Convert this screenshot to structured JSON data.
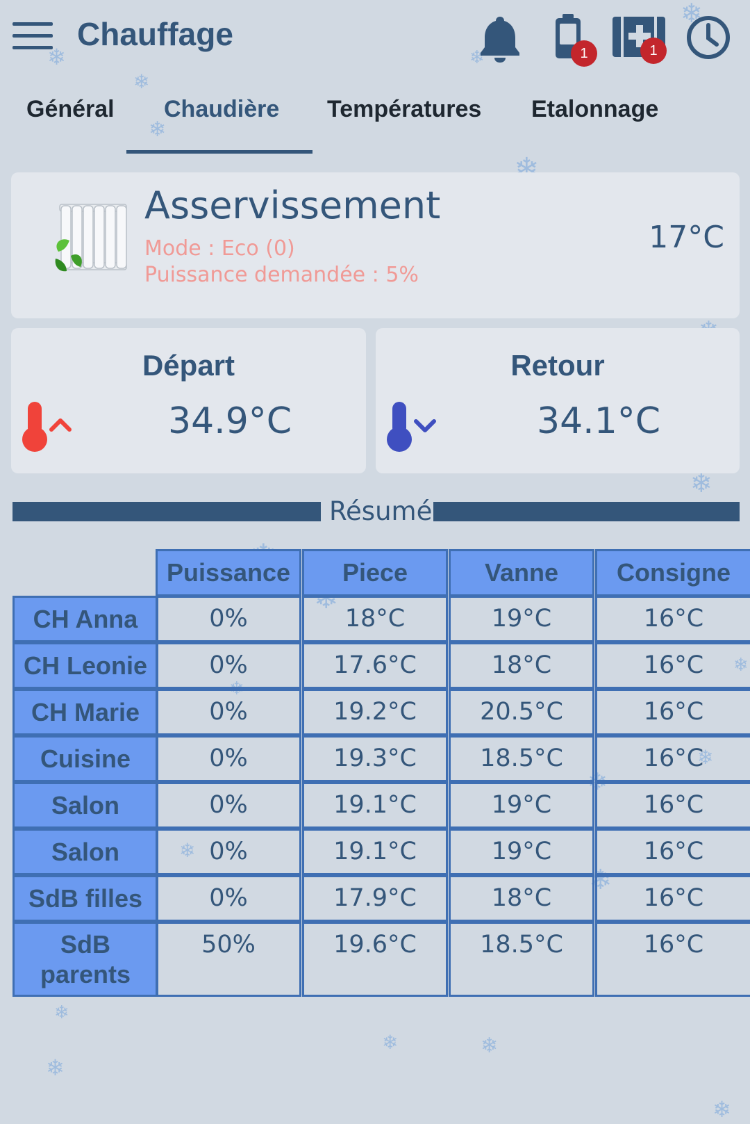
{
  "header": {
    "title": "Chauffage",
    "icons": {
      "menu": "hamburger-menu-icon",
      "notifications": "bell-icon",
      "battery": "battery-icon",
      "medical": "medical-kit-icon",
      "history": "clock-icon"
    },
    "battery_badge": "1",
    "medical_badge": "1"
  },
  "tabs": [
    {
      "label": "Général",
      "active": false
    },
    {
      "label": "Chaudière",
      "active": true
    },
    {
      "label": "Températures",
      "active": false
    },
    {
      "label": "Etalonnage",
      "active": false
    }
  ],
  "servo": {
    "title": "Asservissement",
    "mode": "Mode : Eco (0)",
    "power": "Puissance demandée : 5%",
    "temperature": "17°C",
    "icon": "radiator-eco-icon"
  },
  "depart": {
    "title": "Départ",
    "value": "34.9°C",
    "icon": "thermometer-up-icon"
  },
  "retour": {
    "title": "Retour",
    "value": "34.1°C",
    "icon": "thermometer-down-icon"
  },
  "summary": {
    "title": "Résumé",
    "columns": [
      "Puissance",
      "Piece",
      "Vanne",
      "Consigne"
    ],
    "rows": [
      {
        "name": "CH Anna",
        "values": [
          "0%",
          "18°C",
          "19°C",
          "16°C"
        ]
      },
      {
        "name": "CH Leonie",
        "values": [
          "0%",
          "17.6°C",
          "18°C",
          "16°C"
        ]
      },
      {
        "name": "CH Marie",
        "values": [
          "0%",
          "19.2°C",
          "20.5°C",
          "16°C"
        ]
      },
      {
        "name": "Cuisine",
        "values": [
          "0%",
          "19.3°C",
          "18.5°C",
          "16°C"
        ]
      },
      {
        "name": "Salon",
        "values": [
          "0%",
          "19.1°C",
          "19°C",
          "16°C"
        ]
      },
      {
        "name": "Salon",
        "values": [
          "0%",
          "19.1°C",
          "19°C",
          "16°C"
        ]
      },
      {
        "name": "SdB filles",
        "values": [
          "0%",
          "17.9°C",
          "18°C",
          "16°C"
        ]
      },
      {
        "name": "SdB parents",
        "values": [
          "50%",
          "19.6°C",
          "18.5°C",
          "16°C"
        ]
      }
    ]
  },
  "colors": {
    "primary": "#34567a",
    "table_header": "#6b9af0",
    "table_border": "#3f6fb3",
    "alert_text": "#f09a96",
    "badge": "#c3262c",
    "hot": "#f0433a",
    "cold": "#3f4fc0",
    "background": "#d1d9e2"
  }
}
